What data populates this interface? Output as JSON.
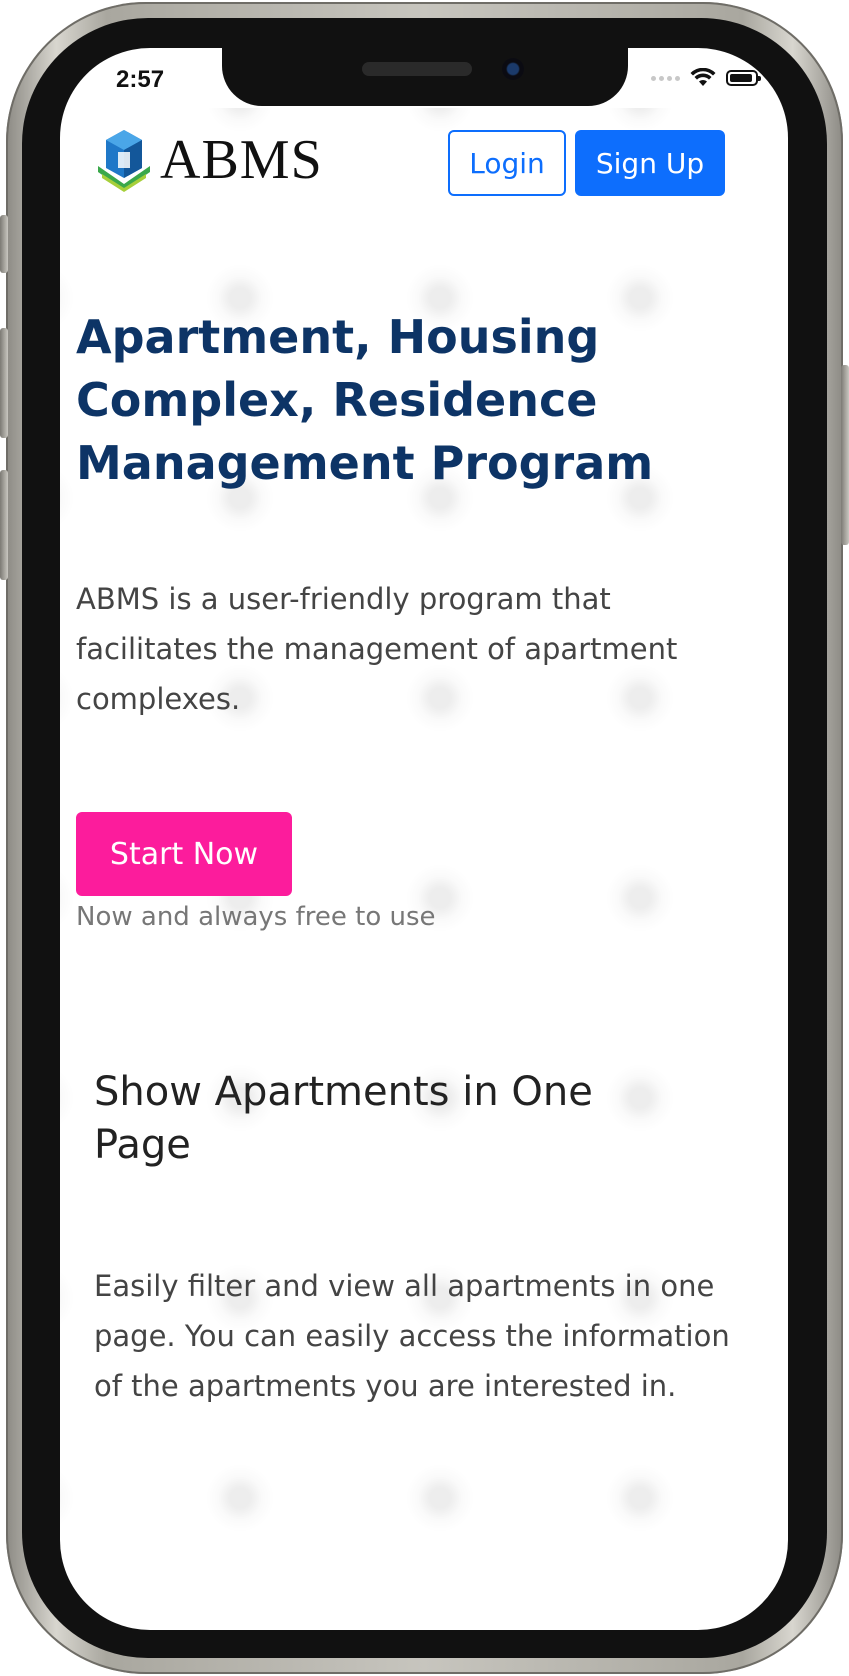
{
  "status_bar": {
    "time": "2:57"
  },
  "nav": {
    "logo_text": "ABMS",
    "login_label": "Login",
    "signup_label": "Sign Up"
  },
  "hero": {
    "title": "Apartment, Housing Complex, Residence Management Program",
    "description": "ABMS is a user-friendly program that facilitates the management of apartment complexes.",
    "cta_label": "Start Now",
    "cta_note": "Now and always free to use"
  },
  "feature": {
    "title": "Show Apartments in One Page",
    "description": "Easily filter and view all apartments in one page. You can easily access the information of the apartments you are interested in."
  },
  "colors": {
    "primary": "#0d6efd",
    "heading": "#0d3466",
    "cta": "#fc1c9c",
    "muted_text": "#777777"
  },
  "icons": [
    "logo-icon",
    "signal-icon",
    "wifi-icon",
    "battery-icon"
  ]
}
